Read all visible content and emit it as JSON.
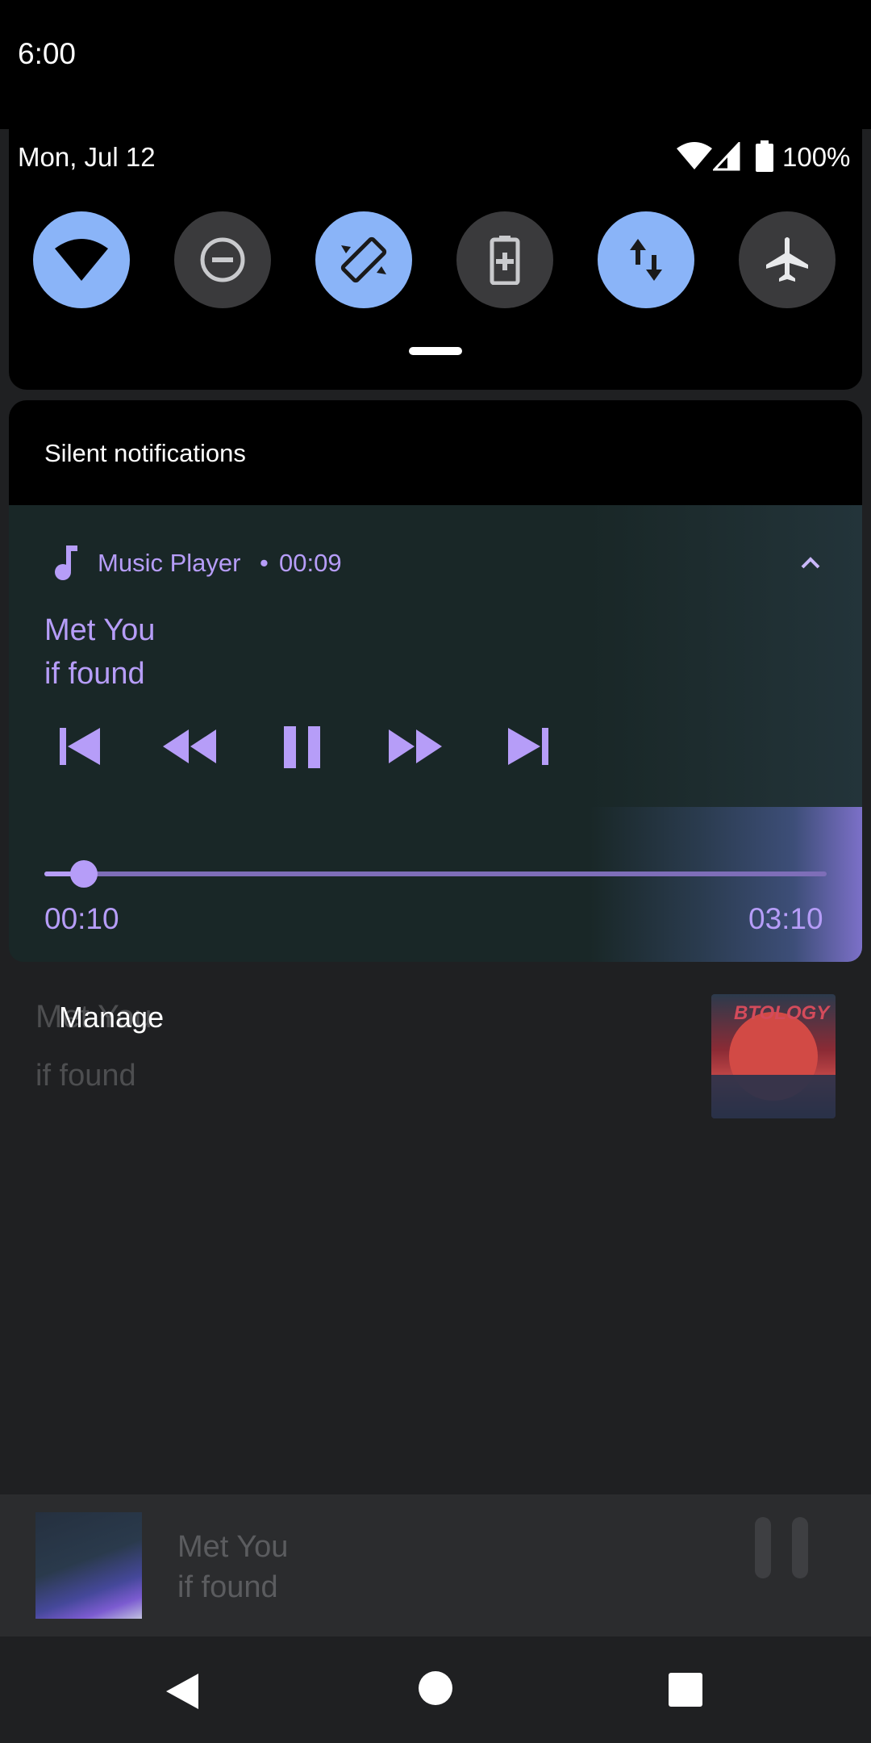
{
  "status_bar": {
    "time": "6:00",
    "date": "Mon, Jul 12",
    "battery": "100%"
  },
  "quick_settings": {
    "tiles": [
      {
        "name": "wifi",
        "on": true
      },
      {
        "name": "do-not-disturb",
        "on": false
      },
      {
        "name": "auto-rotate",
        "on": true
      },
      {
        "name": "battery-saver",
        "on": false
      },
      {
        "name": "mobile-data",
        "on": true
      },
      {
        "name": "airplane-mode",
        "on": false
      }
    ]
  },
  "notifications": {
    "section_label": "Silent notifications",
    "media": {
      "app_name": "Music Player",
      "separator": "•",
      "elapsed": "00:09",
      "title": "Met You",
      "artist": "if found",
      "current_time": "00:10",
      "duration": "03:10",
      "progress": 0.05
    },
    "manage_label": "Manage"
  },
  "background_app": {
    "title": "Met You",
    "artist": "if found",
    "cover_text": "BTOLOGY"
  },
  "mini_player": {
    "title": "Met You",
    "artist": "if found"
  },
  "colors": {
    "accent": "#b69df8",
    "tile_on": "#8ab4f8",
    "tile_off": "#3a3a3c"
  }
}
